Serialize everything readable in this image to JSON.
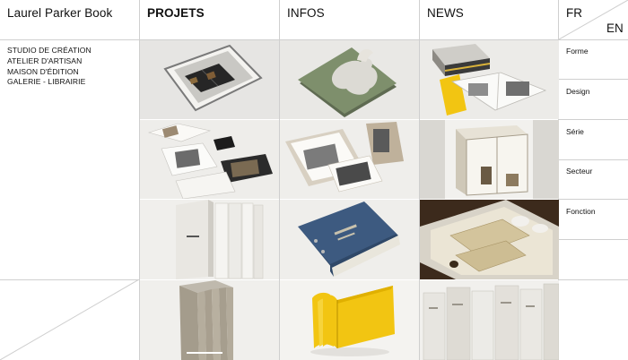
{
  "brand": "Laurel Parker Book",
  "nav": {
    "projets": "PROJETS",
    "infos": "INFOS",
    "news": "NEWS"
  },
  "lang": {
    "fr": "FR",
    "en": "EN"
  },
  "tagline": [
    "STUDIO DE CRÉATION",
    "ATELIER D'ARTISAN",
    "MAISON D'ÉDITION",
    "GALERIE - LIBRAIRIE"
  ],
  "filters": [
    "Forme",
    "Design",
    "Série",
    "Secteur",
    "Fonction"
  ],
  "colors": {
    "line": "#cfcfcf",
    "green_folio": "#7e8f6c",
    "blue_book": "#3d5a80",
    "yellow_book": "#f2c512",
    "text": "#111111"
  },
  "tiles": [
    {
      "name": "tile-framed-book-box"
    },
    {
      "name": "tile-green-cutout-folio"
    },
    {
      "name": "tile-slipcase-photobook"
    },
    {
      "name": "tile-photobook-spread"
    },
    {
      "name": "tile-portfolio-box"
    },
    {
      "name": "tile-display-vitrine"
    },
    {
      "name": "tile-white-slipcases"
    },
    {
      "name": "tile-blue-cloth-book"
    },
    {
      "name": "tile-archive-tray"
    },
    {
      "name": "tile-grey-books"
    },
    {
      "name": "tile-yellow-book"
    },
    {
      "name": "tile-archive-boxes"
    }
  ]
}
